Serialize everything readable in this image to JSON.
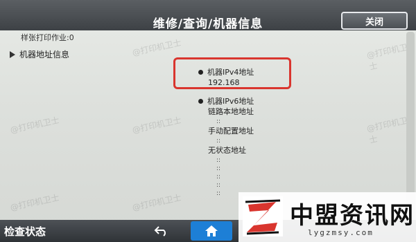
{
  "header": {
    "title": "维修/查询/机器信息",
    "close_label": "关闭"
  },
  "left": {
    "prev_line": "样张打印作业:0",
    "tree_item_label": "机器地址信息"
  },
  "content": {
    "ipv4_label": "机器IPv4地址",
    "ipv4_value": "192.168",
    "ipv6_label": "机器IPv6地址",
    "link_local_label": "链路本地地址",
    "colon": "::",
    "manual_label": "手动配置地址",
    "stateless_label": "无状态地址"
  },
  "bottom": {
    "status_label": "检查状态",
    "back_icon": "back-arrow-icon",
    "home_icon": "home-icon",
    "home_color": "#1d7fd6"
  },
  "watermark": {
    "text": "@打印机卫士"
  },
  "brand": {
    "name": "中盟资讯网",
    "site": "lygzmsy.com",
    "accent": "#d9352e"
  }
}
